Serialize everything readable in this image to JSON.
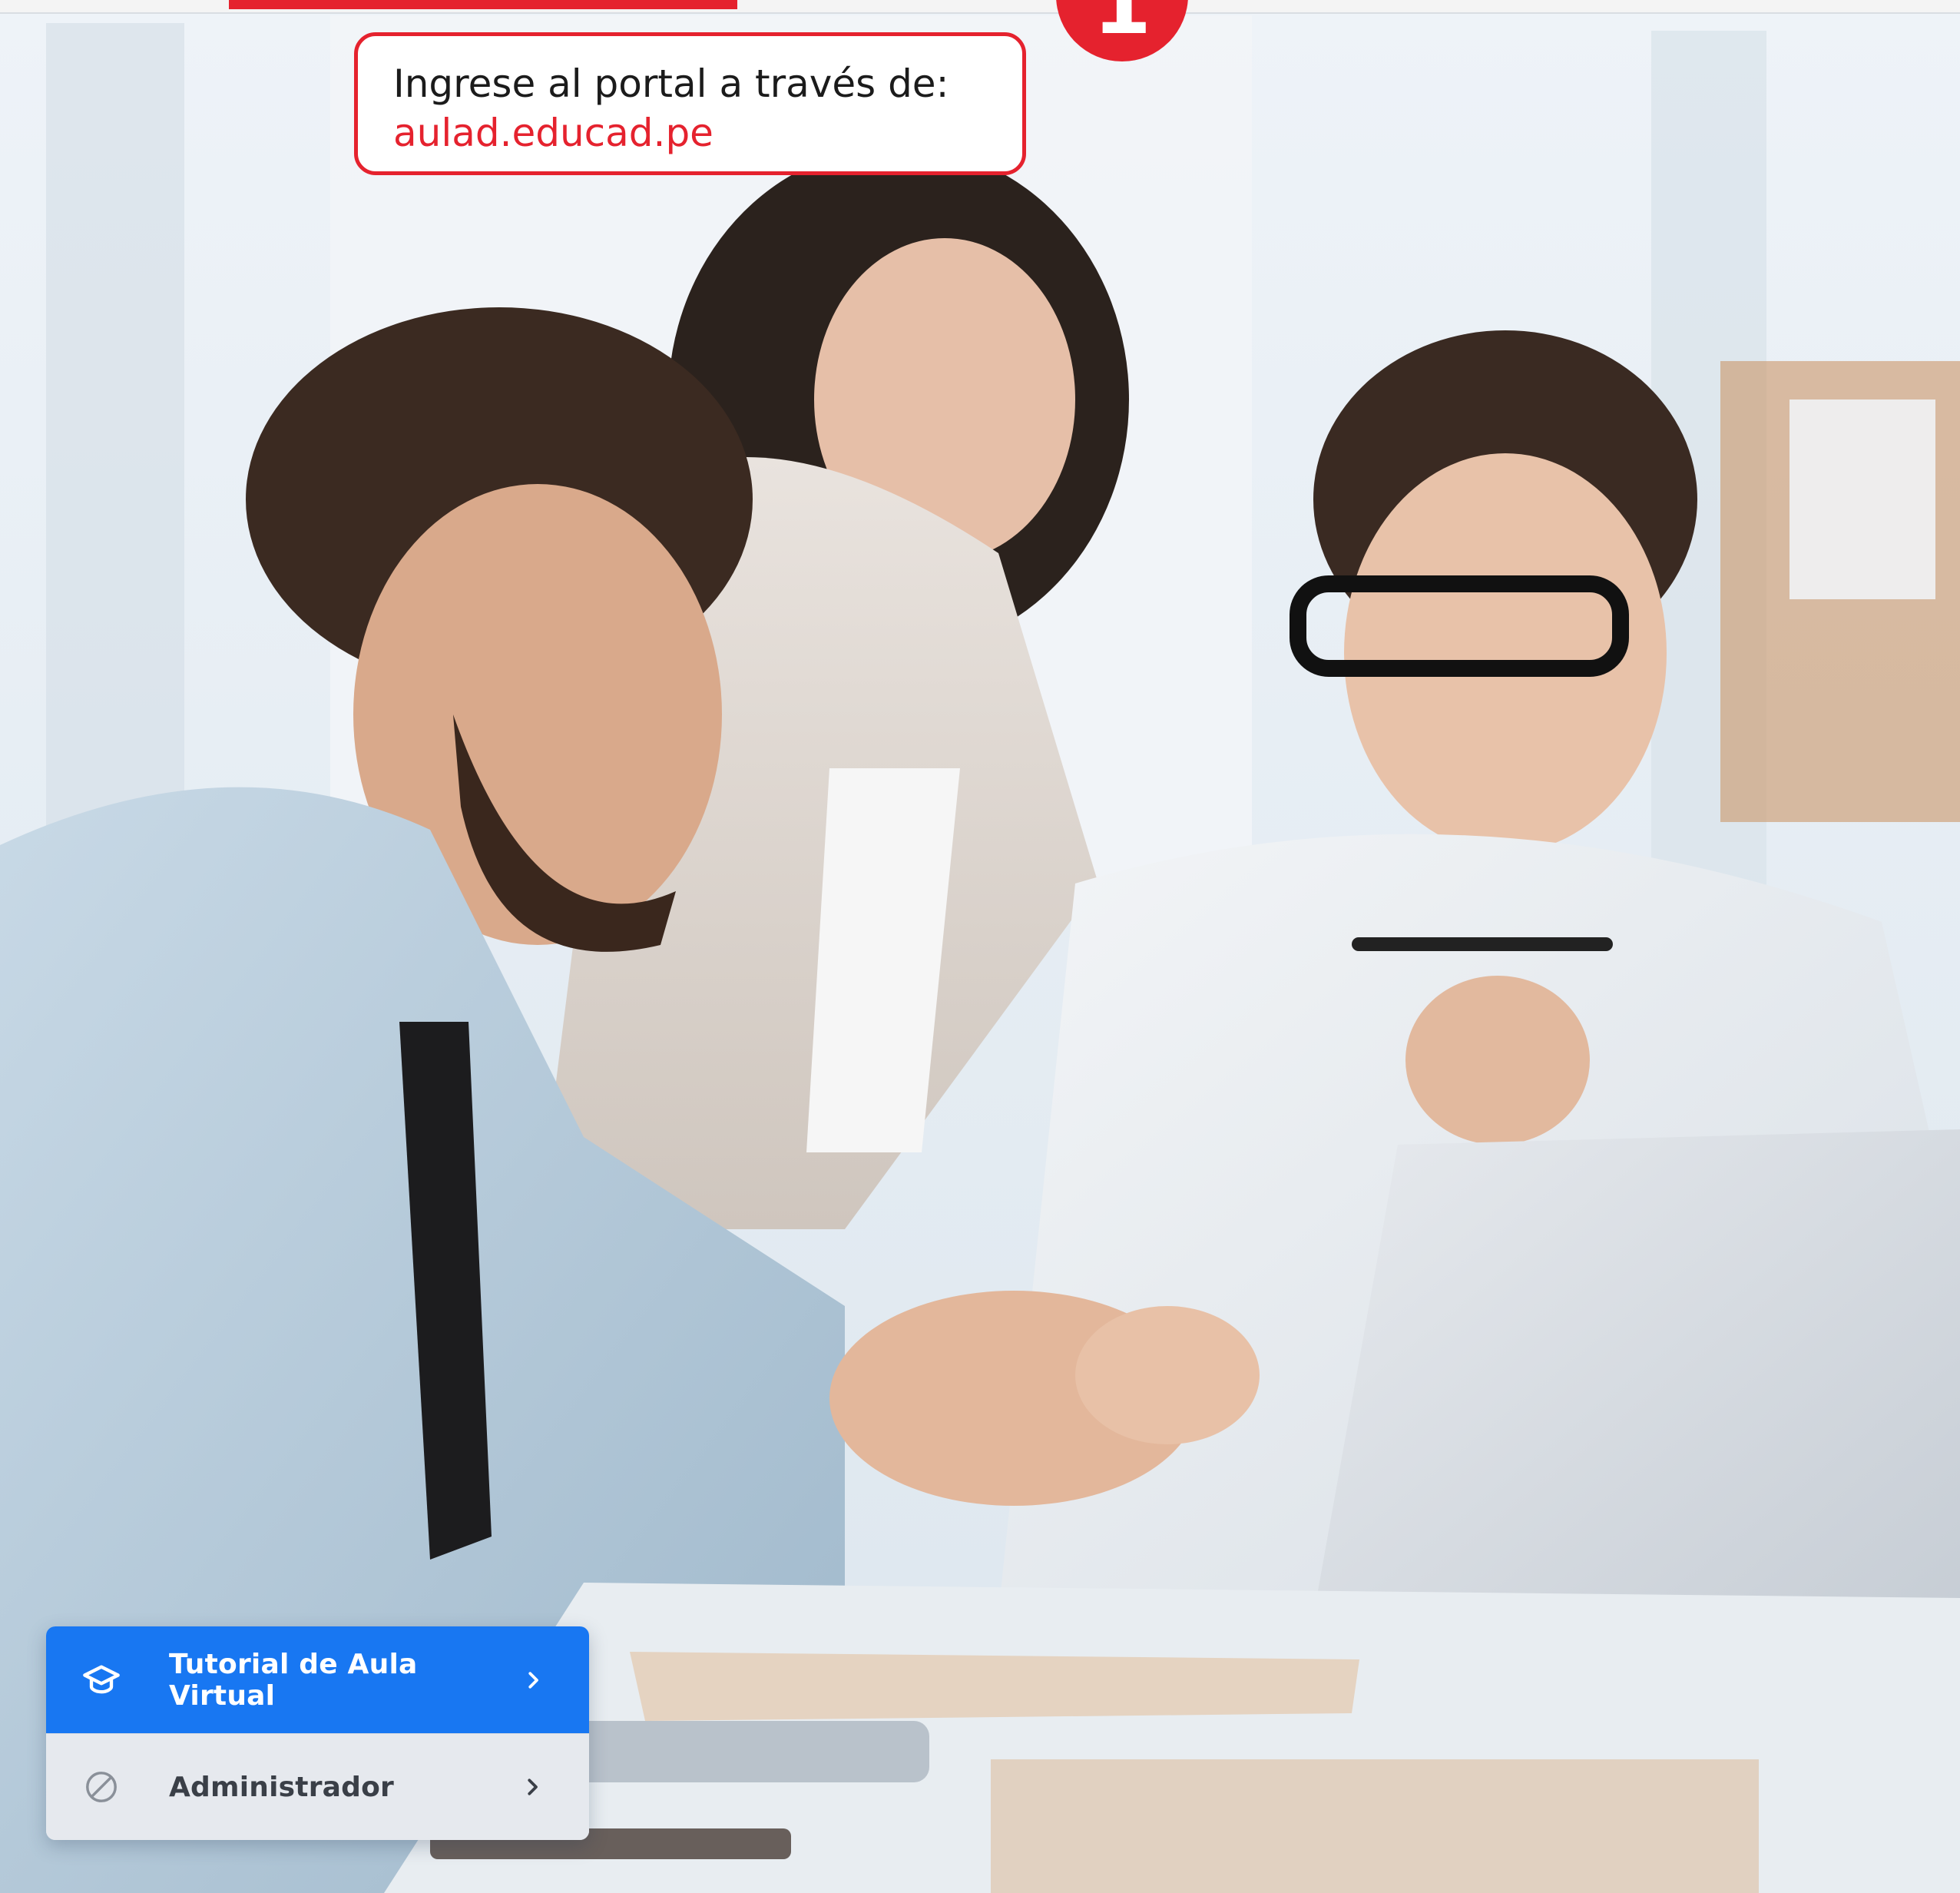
{
  "callout": {
    "instruction": "Ingrese al portal a través de:",
    "url": "aulad.educad.pe"
  },
  "step_badge": {
    "number": "1"
  },
  "menu": {
    "items": [
      {
        "label": "Tutorial de Aula Virtual",
        "icon": "graduation-cap-icon",
        "state": "active"
      },
      {
        "label": "Administrador",
        "icon": "disabled-circle-icon",
        "state": "inactive"
      }
    ]
  },
  "colors": {
    "accent_red": "#e5222e",
    "menu_active_blue": "#1877f2",
    "menu_inactive_bg": "#e6e9ee"
  }
}
